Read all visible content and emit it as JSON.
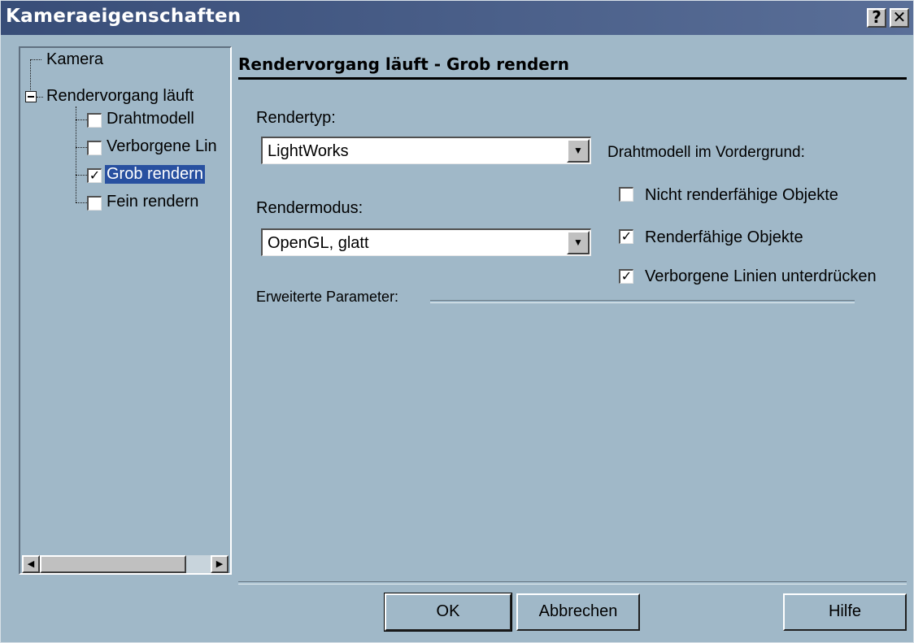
{
  "window": {
    "title": "Kameraeigenschaften",
    "help_button": "?",
    "close_button": "✕"
  },
  "tree": {
    "items": [
      {
        "label": "Kamera"
      },
      {
        "label": "Rendervorgang läuft"
      },
      {
        "label": "Drahtmodell",
        "checked": false
      },
      {
        "label": "Verborgene Lin",
        "checked": false
      },
      {
        "label": "Grob rendern",
        "checked": true,
        "selected": true
      },
      {
        "label": "Fein rendern",
        "checked": false
      }
    ],
    "scroll_left": "◀",
    "scroll_right": "▶"
  },
  "panel": {
    "heading": "Rendervorgang läuft - Grob rendern",
    "render_type": {
      "label": "Rendertyp:",
      "value": "LightWorks"
    },
    "render_mode": {
      "label": "Rendermodus:",
      "value": "OpenGL, glatt"
    },
    "advanced_label": "Erweiterte Parameter:",
    "wireframe": {
      "label": "Drahtmodell im Vordergrund:",
      "options": [
        {
          "label": "Nicht renderfähige Objekte",
          "checked": false
        },
        {
          "label": "Renderfähige Objekte",
          "checked": true
        },
        {
          "label": "Verborgene Linien unterdrücken",
          "checked": true
        }
      ]
    },
    "dropdown_arrow": "▼"
  },
  "buttons": {
    "ok": "OK",
    "cancel": "Abbrechen",
    "help": "Hilfe"
  }
}
